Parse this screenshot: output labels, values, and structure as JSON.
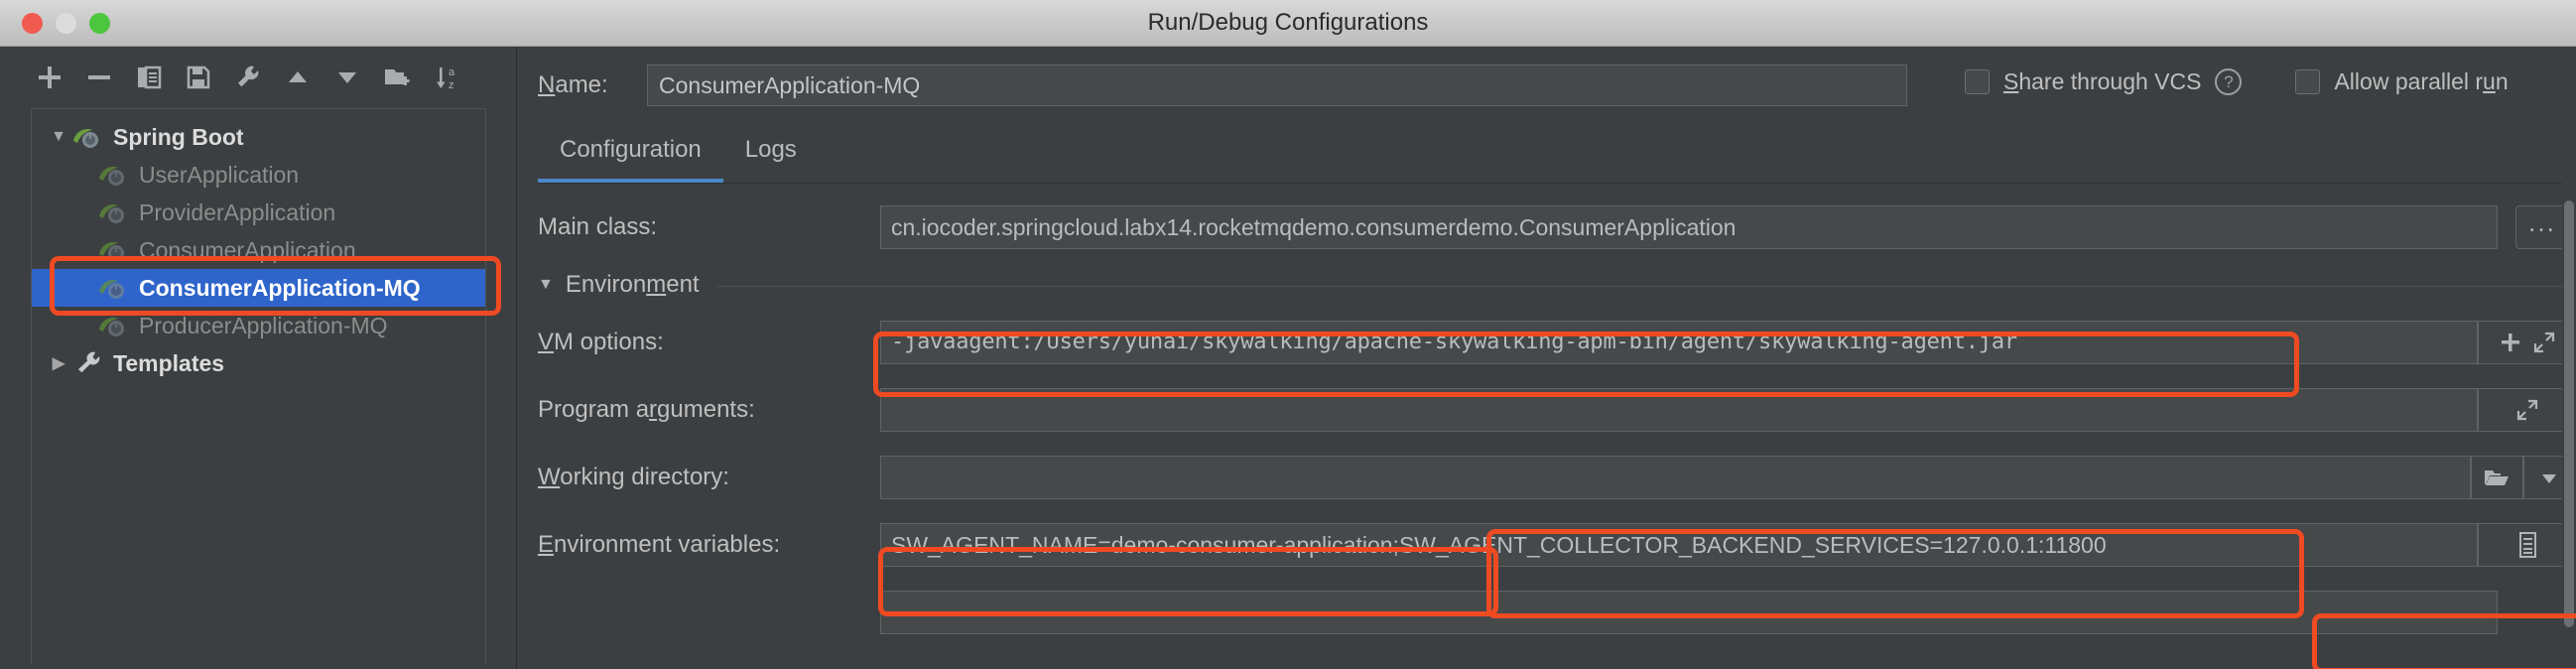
{
  "window": {
    "title": "Run/Debug Configurations",
    "traffic_lights": [
      "close-red",
      "minimize-yellow",
      "zoom-green"
    ]
  },
  "toolbar": {
    "buttons": [
      {
        "name": "add-configuration",
        "icon": "plus-icon"
      },
      {
        "name": "remove-configuration",
        "icon": "minus-icon"
      },
      {
        "name": "copy-configuration",
        "icon": "copy-icon"
      },
      {
        "name": "save-configuration",
        "icon": "save-icon"
      },
      {
        "name": "edit-templates",
        "icon": "wrench-icon"
      },
      {
        "name": "move-up",
        "icon": "triangle-up-icon"
      },
      {
        "name": "move-down",
        "icon": "triangle-down-icon"
      },
      {
        "name": "new-folder",
        "icon": "folder-plus-icon"
      },
      {
        "name": "sort-alphabetically",
        "icon": "sort-az-icon"
      }
    ]
  },
  "tree": {
    "root": {
      "label": "Spring Boot",
      "expanded": true,
      "arrow": "▼"
    },
    "children": [
      {
        "label": "UserApplication",
        "selected": false
      },
      {
        "label": "ProviderApplication",
        "selected": false
      },
      {
        "label": "ConsumerApplication",
        "selected": false
      },
      {
        "label": "ConsumerApplication-MQ",
        "selected": true
      },
      {
        "label": "ProducerApplication-MQ",
        "selected": false
      }
    ],
    "templates": {
      "label": "Templates",
      "expanded": false,
      "arrow": "▶"
    }
  },
  "name_row": {
    "label": "Name:",
    "label_mnemonic": "N",
    "label_rest": "ame:",
    "value": "ConsumerApplication-MQ"
  },
  "options": {
    "share_through_vcs": {
      "label_mnemonic": "S",
      "label_rest": "hare through VCS",
      "checked": false
    },
    "help_glyph": "?",
    "allow_parallel_run": {
      "label_prefix": "Allow parallel r",
      "label_mnemonic": "u",
      "label_suffix": "n",
      "checked": false
    }
  },
  "tabs": [
    {
      "label": "Configuration",
      "active": true
    },
    {
      "label": "Logs",
      "active": false
    }
  ],
  "form": {
    "main_class": {
      "label": "Main class:",
      "value": "cn.iocoder.springcloud.labx14.rocketmqdemo.consumerdemo.ConsumerApplication",
      "browse_label": "..."
    },
    "environment_section": {
      "label": "Environment",
      "label_mnemonic": "m",
      "expanded": true,
      "arrow": "▼"
    },
    "vm_options": {
      "label_mnemonic": "V",
      "label_rest": "M options:",
      "value": "-javaagent:/Users/yunai/skywalking/apache-skywalking-apm-bin/agent/skywalking-agent.jar",
      "buttons": [
        "plus-icon",
        "expand-icon"
      ]
    },
    "program_arguments": {
      "label_prefix": "Program a",
      "label_mnemonic": "r",
      "label_suffix": "guments:",
      "value": "",
      "buttons": [
        "expand-icon"
      ]
    },
    "working_directory": {
      "label_mnemonic": "W",
      "label_rest": "orking directory:",
      "value": "",
      "buttons": [
        "folder-icon",
        "chevron-down-icon"
      ]
    },
    "environment_variables": {
      "label_mnemonic": "E",
      "label_rest": "nvironment variables:",
      "value": "SW_AGENT_NAME=demo-consumer-application;SW_AGENT_COLLECTOR_BACKEND_SERVICES=127.0.0.1:11800",
      "value_part1": "SW_AGENT_NAME=demo-consumer-application",
      "value_part2": "SW_AGENT_COLLECTOR_BACKEND_SERVICES=127.0.0.1:11800",
      "buttons": [
        "list-edit-icon"
      ]
    }
  },
  "annotations": {
    "highlight_color": "#f04a23",
    "boxes": [
      {
        "name": "selected-config-highlight"
      },
      {
        "name": "vm-options-highlight"
      },
      {
        "name": "env-var-name-highlight"
      },
      {
        "name": "env-var-backend-highlight"
      },
      {
        "name": "bottom-partial-highlight"
      }
    ]
  }
}
